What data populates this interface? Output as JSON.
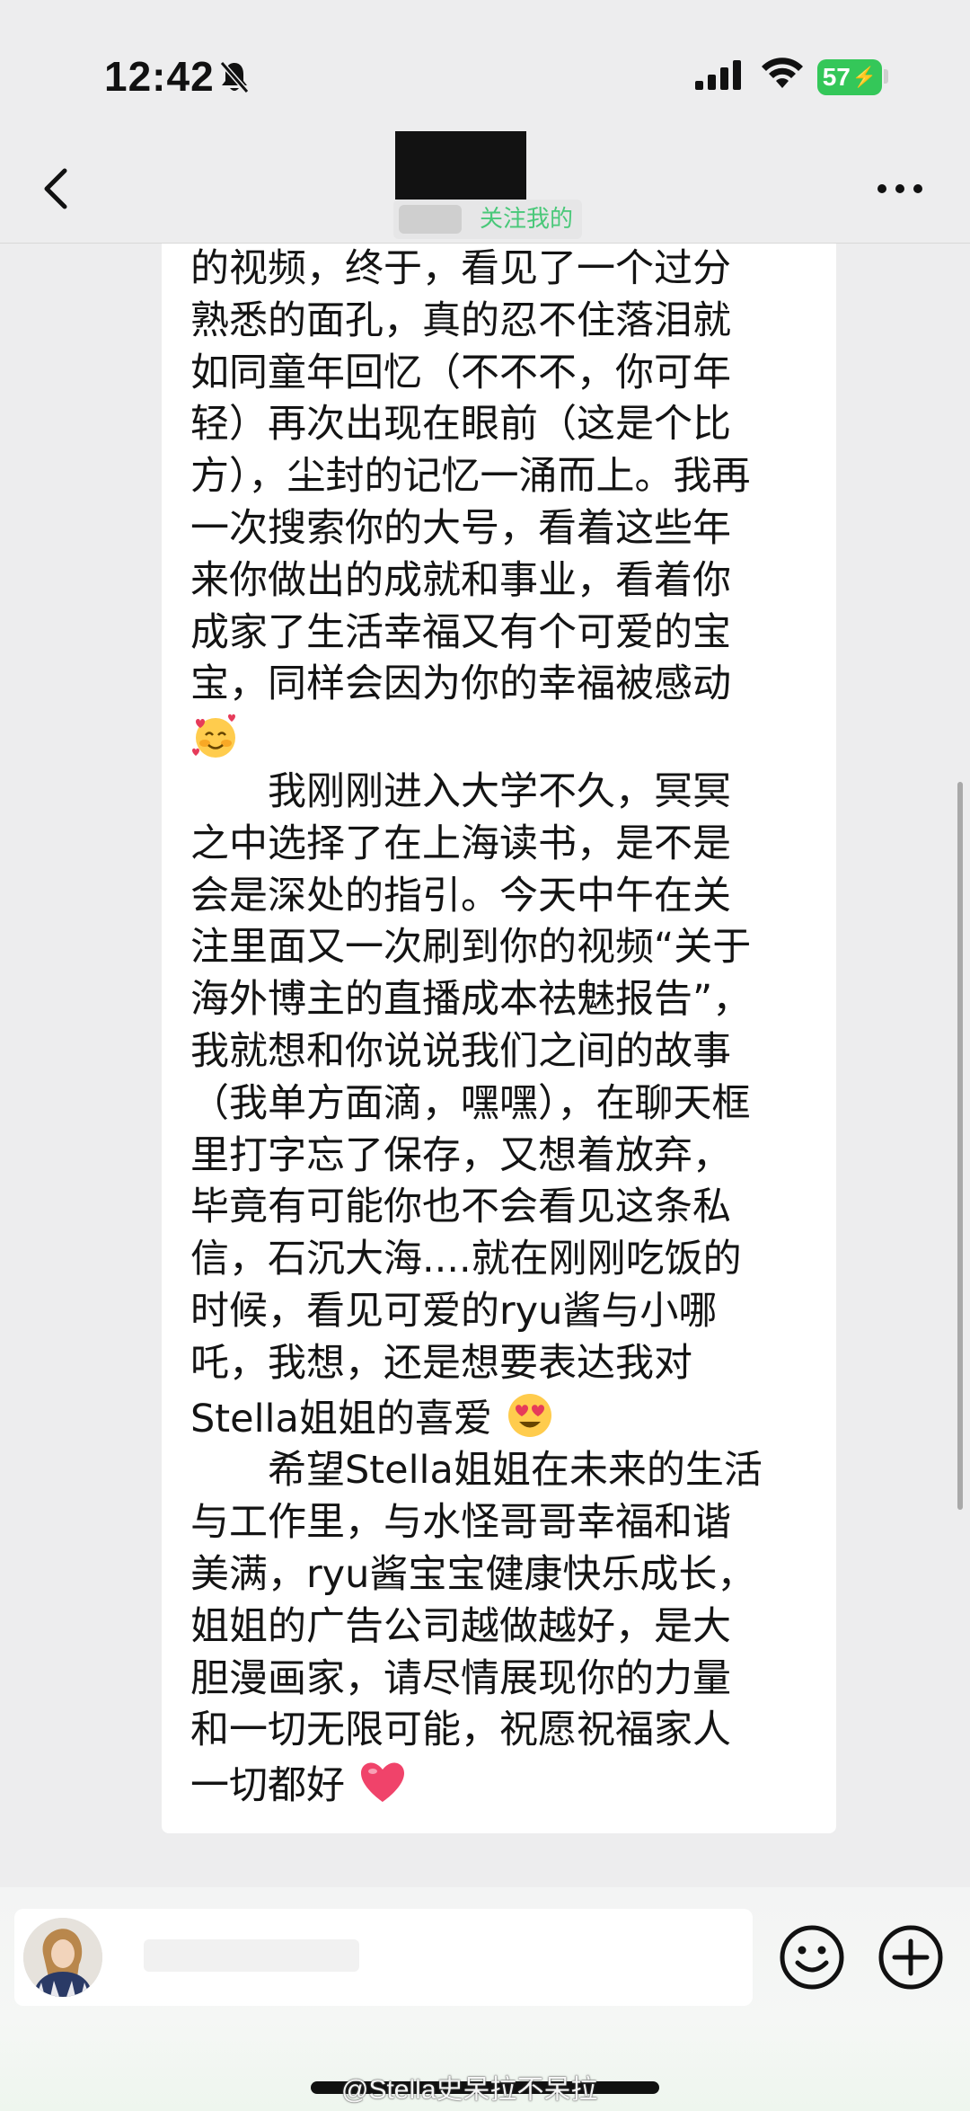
{
  "status_bar": {
    "time": "12:42",
    "battery": "57",
    "icons": [
      "bell-mute-icon",
      "cellular-signal-icon",
      "wifi-icon",
      "battery-charging-icon"
    ]
  },
  "header": {
    "follow_tag": "关注我的",
    "icons": [
      "chevron-left-icon",
      "more-horizontal-icon"
    ]
  },
  "message": {
    "lines": [
      "的视频，终于，看见了一个过分",
      "熟悉的面孔，真的忍不住落泪就",
      "如同童年回忆（不不不，你可年",
      "轻）再次出现在眼前（这是个比",
      "方），尘封的记忆一涌而上。我再",
      "一次搜索你的大号，看着这些年",
      "来你做出的成就和事业，看着你",
      "成家了生活幸福又有个可爱的宝",
      "宝，同样会因为你的幸福被感动"
    ],
    "emoji_1": "🥰",
    "para2_lines": [
      "　　我刚刚进入大学不久，冥冥",
      "之中选择了在上海读书，是不是",
      "会是深处的指引。今天中午在关",
      "注里面又一次刷到你的视频“关于",
      "海外博主的直播成本祛魅报告”，",
      "我就想和你说说我们之间的故事",
      "（我单方面滴，嘿嘿），在聊天框",
      "里打字忘了保存，又想着放弃，",
      "毕竟有可能你也不会看见这条私",
      "信，石沉大海....就在刚刚吃饭的",
      "时候，看见可爱的ryu酱与小哪",
      "吒，我想，还是想要表达我对"
    ],
    "para2_last": "Stella姐姐的喜爱",
    "emoji_2": "😍",
    "para3_lines": [
      "　　希望Stella姐姐在未来的生活",
      "与工作里，与水怪哥哥幸福和谐",
      "美满，ryu酱宝宝健康快乐成长，",
      "姐姐的广告公司越做越好，是大",
      "胆漫画家，请尽情展现你的力量",
      "和一切无限可能，祝愿祝福家人"
    ],
    "para3_last": "一切都好",
    "emoji_3": "❤️"
  },
  "bottom_bar": {
    "input_placeholder": "",
    "icons": [
      "avatar",
      "emoji-smile-icon",
      "plus-circle-icon"
    ]
  },
  "watermark": "@Stella史呆拉不呆拉",
  "colors": {
    "background": "#ededee",
    "bubble": "#ffffff",
    "follow_green": "#49c879",
    "battery_green": "#34c759"
  }
}
